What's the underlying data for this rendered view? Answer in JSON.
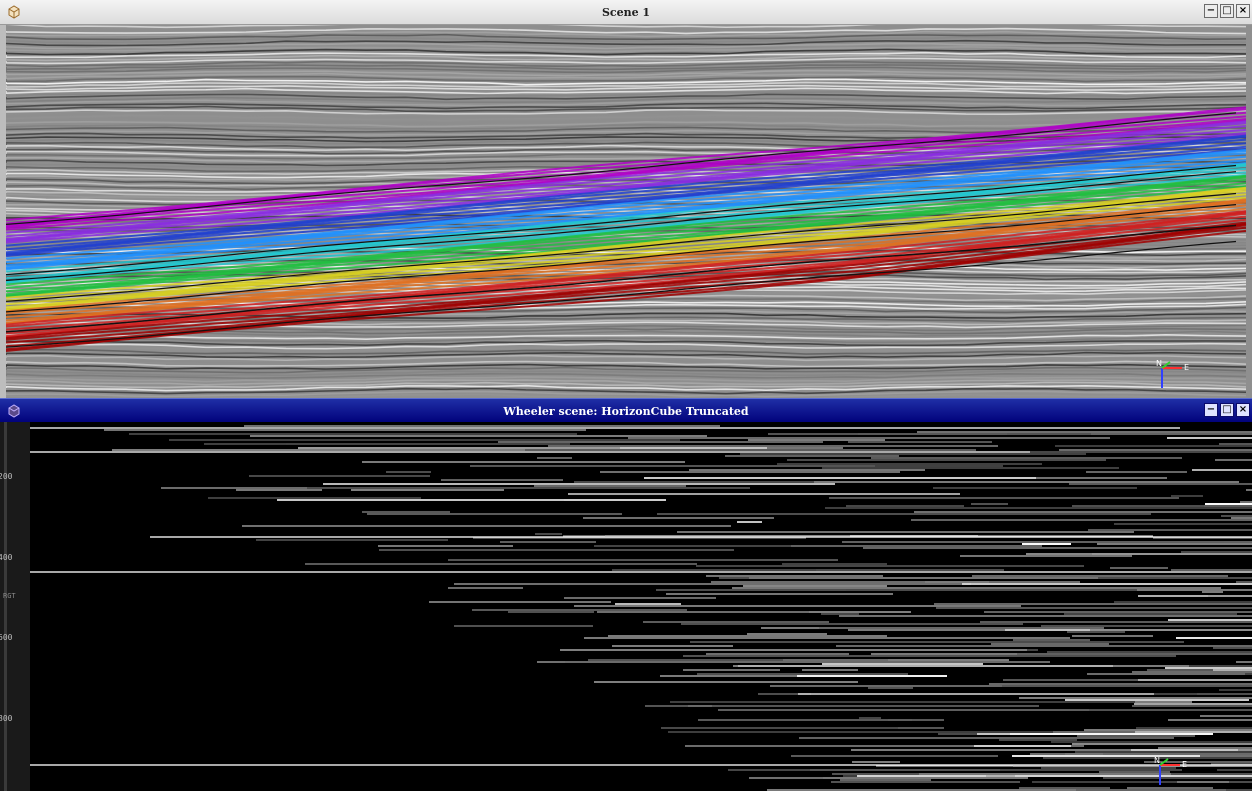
{
  "scene1": {
    "title": "Scene 1",
    "buttons": {
      "minimize": "−",
      "maximize": "□",
      "close": "×"
    },
    "compass": {
      "n": "N",
      "e": "E"
    }
  },
  "wheeler": {
    "title": "Wheeler scene: HorizonCube Truncated",
    "buttons": {
      "minimize": "−",
      "maximize": "□",
      "close": "×"
    },
    "axis_ticks": [
      "200",
      "400",
      "600",
      "800"
    ],
    "axis_name": "RGT",
    "compass": {
      "n": "N",
      "e": "E"
    }
  },
  "colors": {
    "titlebar_active": "#0a0a8a",
    "horizon_palette": [
      "#b000c8",
      "#8a2be2",
      "#2040d0",
      "#1e90ff",
      "#20c8d0",
      "#20c040",
      "#d8d020",
      "#e07020",
      "#d02020",
      "#a00000"
    ]
  }
}
